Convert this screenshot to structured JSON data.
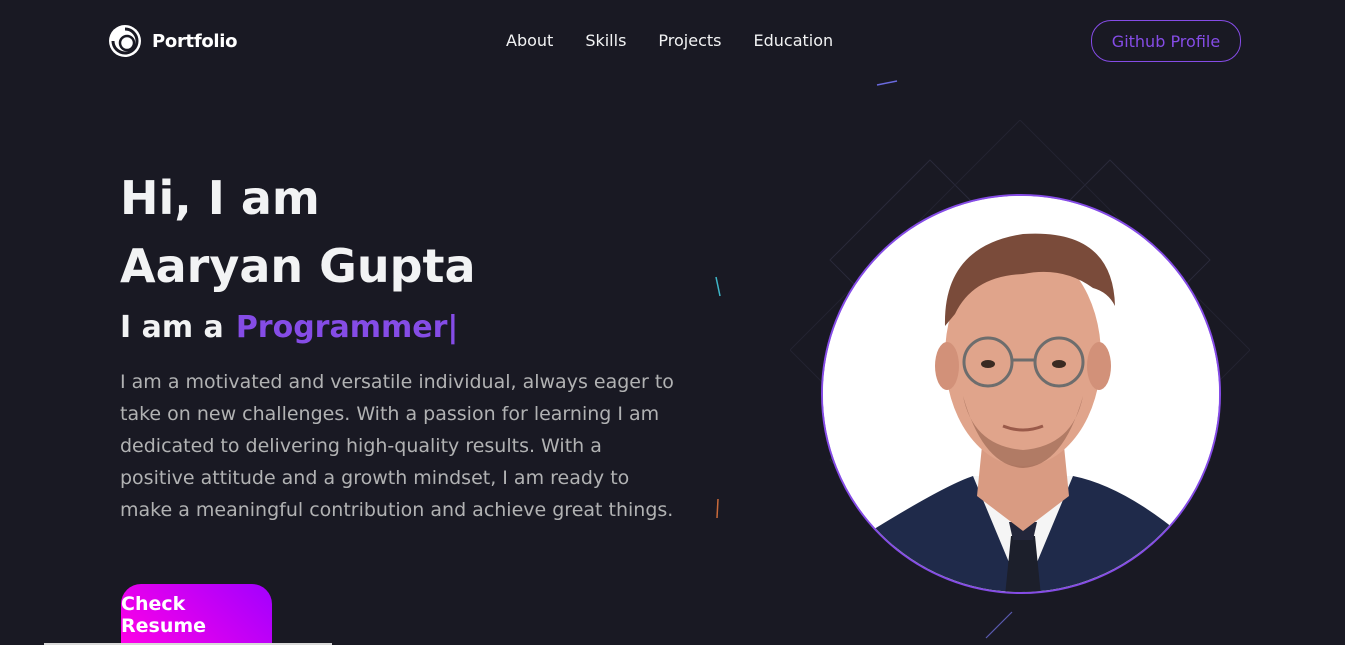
{
  "nav": {
    "logo_text": "Portfolio",
    "menu": [
      "About",
      "Skills",
      "Projects",
      "Education"
    ],
    "github_label": "Github Profile"
  },
  "hero": {
    "greeting": "Hi, I am",
    "name": "Aaryan Gupta",
    "role_prefix": "I am a",
    "role": "Programmer|",
    "description": "I am a motivated and versatile individual, always eager to take on new challenges. With a passion for learning I am dedicated to delivering high-quality results. With a positive attitude and a growth mindset, I am ready to make a meaningful contribution and achieve great things.",
    "cta_label": "Check Resume"
  },
  "colors": {
    "background": "#191923",
    "accent": "#854ce6",
    "button_gradient_start": "#a200ff",
    "button_gradient_end": "#ff00e6",
    "text_primary": "#f2f3f4",
    "text_secondary": "#b1b2b3"
  }
}
